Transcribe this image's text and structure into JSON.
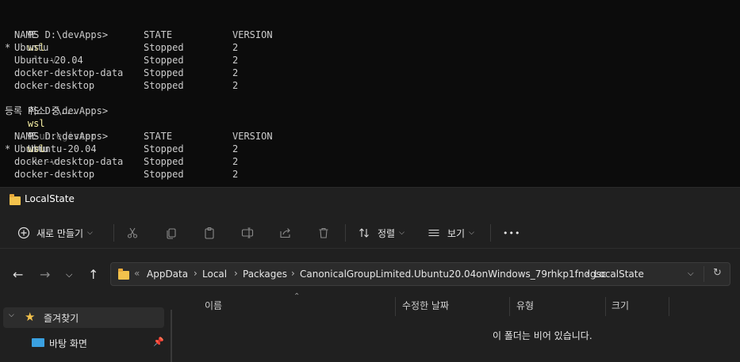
{
  "terminal": {
    "prompt": "PS D:\\devApps>",
    "wsl_cmd": "wsl",
    "list_flags": "-l -v",
    "unregister_flag": "--unregister",
    "unregister_arg": "Ubuntu-20.04",
    "unregister_msg": "등록 취소 중...",
    "headers": [
      "NAME",
      "STATE",
      "VERSION"
    ],
    "list1": [
      {
        "mark": "*",
        "name": "Ubuntu",
        "state": "Stopped",
        "version": "2"
      },
      {
        "mark": "",
        "name": "Ubuntu-20.04",
        "state": "Stopped",
        "version": "2"
      },
      {
        "mark": "",
        "name": "docker-desktop-data",
        "state": "Stopped",
        "version": "2"
      },
      {
        "mark": "",
        "name": "docker-desktop",
        "state": "Stopped",
        "version": "2"
      }
    ],
    "list2": [
      {
        "mark": "*",
        "name": "Ubuntu",
        "state": "Stopped",
        "version": "2"
      },
      {
        "mark": "",
        "name": "docker-desktop-data",
        "state": "Stopped",
        "version": "2"
      },
      {
        "mark": "",
        "name": "docker-desktop",
        "state": "Stopped",
        "version": "2"
      }
    ]
  },
  "explorer": {
    "title": "LocalState",
    "toolbar": {
      "new_label": "새로 만들기",
      "sort_label": "정렬",
      "view_label": "보기",
      "more_label": "•••"
    },
    "icons": {
      "new": "plus-circle-icon",
      "cut": "scissors-icon",
      "copy": "copy-icon",
      "paste": "paste-icon",
      "rename": "rename-icon",
      "share": "share-icon",
      "delete": "trash-icon",
      "sort": "sort-icon",
      "view": "view-icon"
    },
    "address": {
      "overflow": "«",
      "crumbs": [
        "AppData",
        "Local",
        "Packages",
        "CanonicalGroupLimited.Ubuntu20.04onWindows_79rhkp1fndgsc",
        "LocalState"
      ]
    },
    "sidebar": {
      "favorites": "즐겨찾기",
      "desktop": "바탕 화면"
    },
    "columns": [
      "이름",
      "수정한 날짜",
      "유형",
      "크기"
    ],
    "empty_message": "이 폴더는 비어 있습니다."
  },
  "colors": {
    "terminal_bg": "#0c0c0c",
    "command": "#f9f1a5",
    "flag": "#767676",
    "explorer_bg": "#202020",
    "folder": "#f3c24c"
  }
}
